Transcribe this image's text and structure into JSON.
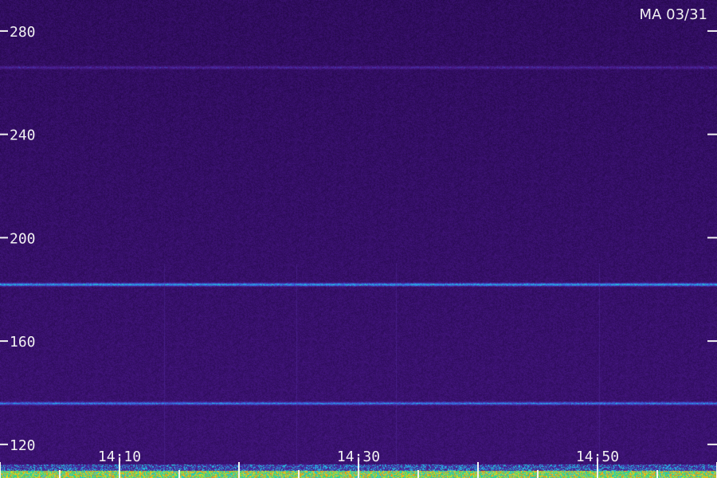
{
  "chart_data": {
    "type": "heatmap",
    "corner_label": "MA 03/31",
    "title": "",
    "xlabel": "",
    "ylabel": "",
    "y_ticks": [
      120,
      160,
      200,
      240,
      280
    ],
    "x_ticks": [
      "14:10",
      "14:30",
      "14:50"
    ],
    "y_range": [
      107,
      292
    ],
    "x_range_minutes": [
      0,
      60
    ],
    "colormap": [
      "#0a0018",
      "#2a0a55",
      "#4a1a8a",
      "#3a5ad8",
      "#22c0e8",
      "#2ad870",
      "#e8e020",
      "#ff7a10"
    ],
    "background_color": "#1e0a34",
    "features": {
      "horizontal_bands": [
        {
          "y": 182,
          "intensity": 0.45
        },
        {
          "y": 136,
          "intensity": 0.35
        },
        {
          "y": 266,
          "intensity": 0.18
        }
      ],
      "bright_bottom_band": {
        "y_from": 107,
        "y_to": 110
      }
    }
  }
}
